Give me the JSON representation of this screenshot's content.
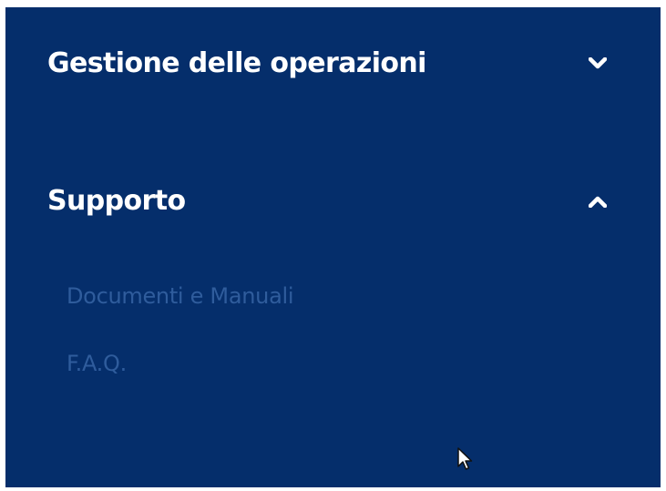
{
  "nav": {
    "sections": [
      {
        "title": "Gestione delle operazioni",
        "state": "collapsed",
        "toggle_icon": "chevron-down-icon"
      },
      {
        "title": "Supporto",
        "state": "expanded",
        "toggle_icon": "chevron-up-icon",
        "links": [
          "Documenti e Manuali",
          "F.A.Q."
        ]
      }
    ]
  },
  "colors": {
    "panel_background": "#052e6b",
    "header_text": "#ffffff",
    "link_text": "#2f5c9c"
  },
  "cursor_icon": "mouse-pointer-icon"
}
